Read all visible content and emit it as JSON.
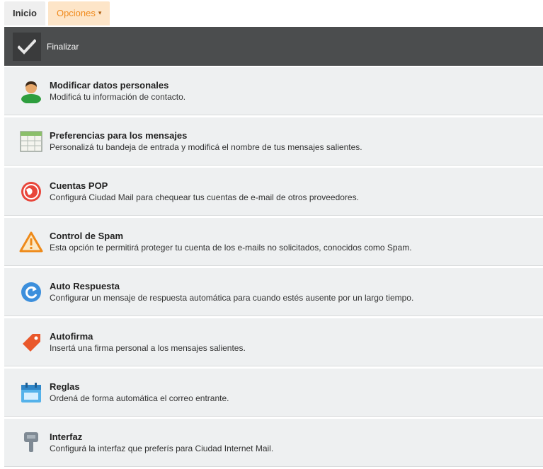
{
  "tabs": {
    "inicio": "Inicio",
    "opciones": "Opciones",
    "opciones_caret": "▾"
  },
  "toolbar": {
    "finalizar": "Finalizar"
  },
  "menu": {
    "items": [
      {
        "title": "Modificar datos personales",
        "desc": "Modificá tu información de contacto.",
        "icon": "user-icon"
      },
      {
        "title": "Preferencias para los mensajes",
        "desc": "Personalizá tu bandeja de entrada y modificá el nombre de tus mensajes salientes.",
        "icon": "table-icon"
      },
      {
        "title": "Cuentas POP",
        "desc": "Configurá Ciudad Mail para chequear tus cuentas de e-mail de otros proveedores.",
        "icon": "globe-icon"
      },
      {
        "title": "Control de Spam",
        "desc": "Esta opción te permitirá proteger tu cuenta de los e-mails no solicitados, conocidos como Spam.",
        "icon": "warning-icon"
      },
      {
        "title": "Auto Respuesta",
        "desc": "Configurar un mensaje de respuesta automática para cuando estés ausente por un largo tiempo.",
        "icon": "reply-icon"
      },
      {
        "title": "Autofirma",
        "desc": "Insertá una firma personal a los mensajes salientes.",
        "icon": "tag-icon"
      },
      {
        "title": "Reglas",
        "desc": "Ordená de forma automática el correo entrante.",
        "icon": "calendar-icon"
      },
      {
        "title": "Interfaz",
        "desc": "Configurá la interfaz que preferís para Ciudad Internet Mail.",
        "icon": "key-icon"
      }
    ]
  }
}
